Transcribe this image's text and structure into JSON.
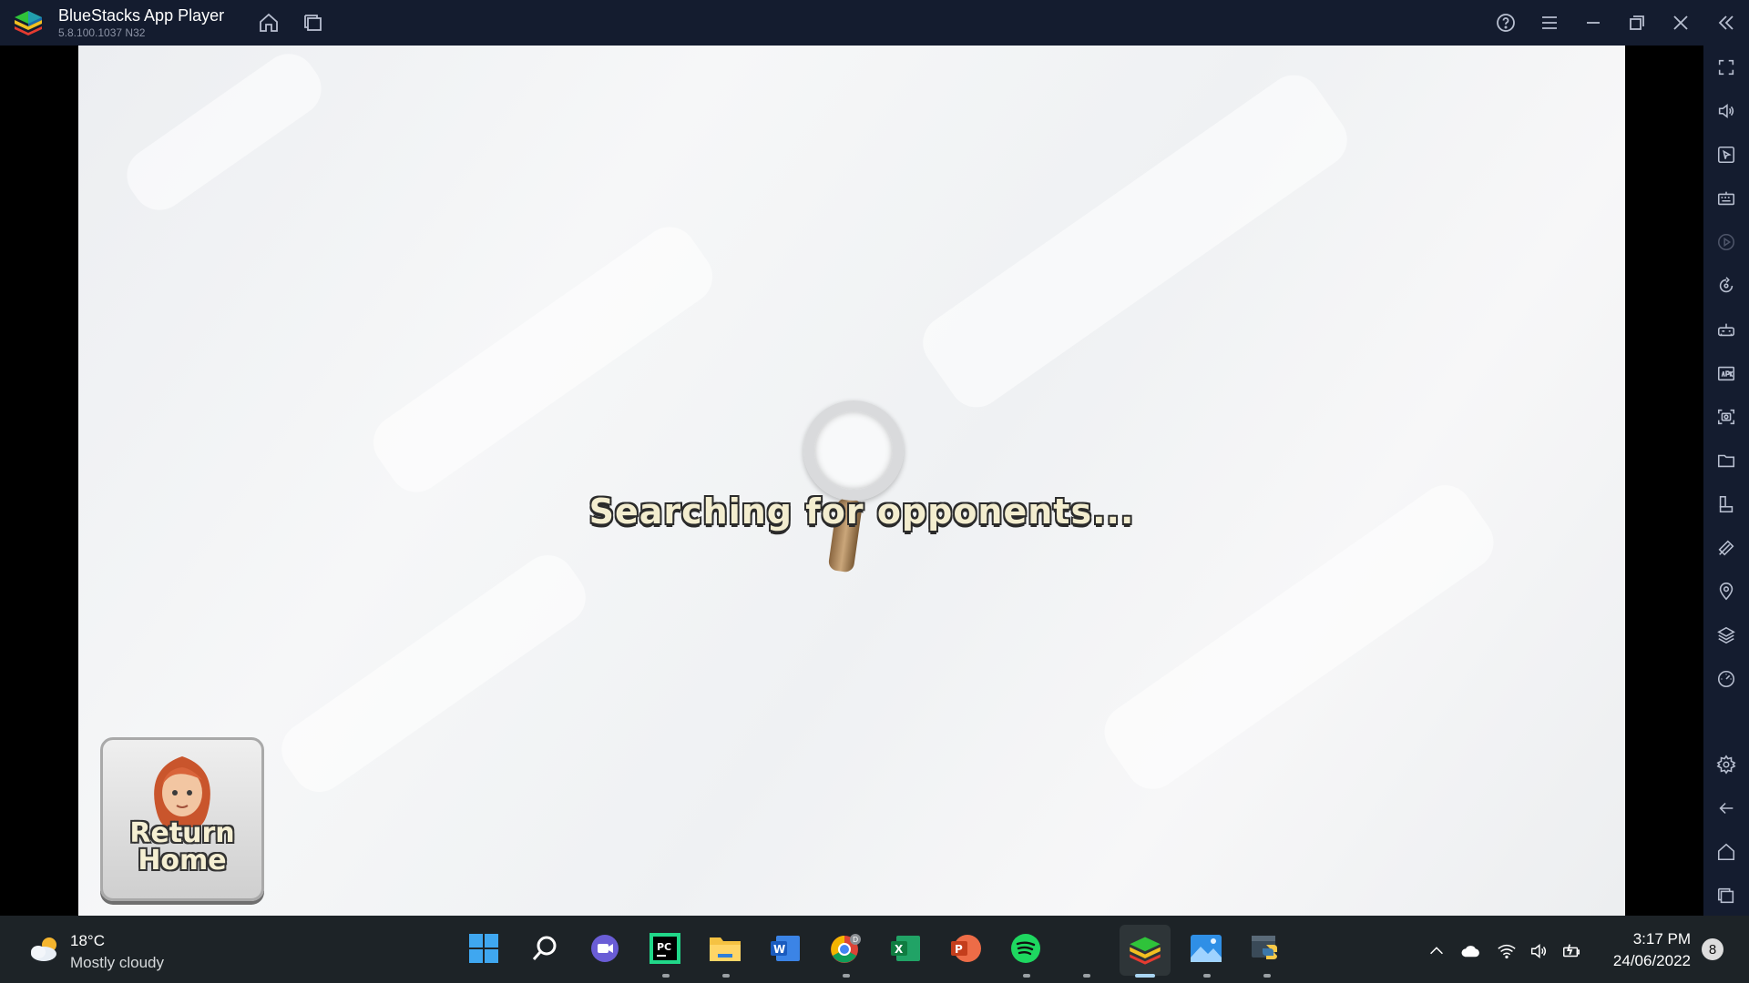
{
  "titlebar": {
    "title": "BlueStacks App Player",
    "version": "5.8.100.1037  N32",
    "icons": [
      "home-icon",
      "multi-instance-icon",
      "help-icon",
      "menu-icon",
      "minimize-icon",
      "restore-icon",
      "close-icon",
      "collapse-sidebar-icon"
    ]
  },
  "game": {
    "search_text": "Searching for opponents...",
    "return_home_line1": "Return",
    "return_home_line2": "Home"
  },
  "sidebar": {
    "icons": [
      "fullscreen-icon",
      "volume-icon",
      "pointer-icon",
      "keyboard-icon",
      "macro-play-icon",
      "rotate-icon",
      "gamepad-icon",
      "apk-icon",
      "screenshot-icon",
      "folder-icon",
      "multi-instance-manager-icon",
      "eco-mode-icon",
      "location-icon",
      "layers-icon",
      "performance-icon",
      "settings-icon",
      "back-icon",
      "home-icon",
      "recent-apps-icon"
    ]
  },
  "taskbar": {
    "weather_temp": "18°C",
    "weather_desc": "Mostly cloudy",
    "apps": [
      "start-icon",
      "search-icon",
      "teams-icon",
      "pycharm-icon",
      "file-explorer-icon",
      "word-icon",
      "chrome-icon",
      "excel-icon",
      "powerpoint-icon",
      "spotify-icon",
      "bluestacks-icon",
      "photos-icon",
      "python-icon"
    ],
    "time": "3:17 PM",
    "date": "24/06/2022",
    "notifications": "8",
    "colors": {
      "accent": "#a9d5f2",
      "background": "#1d2327"
    }
  }
}
